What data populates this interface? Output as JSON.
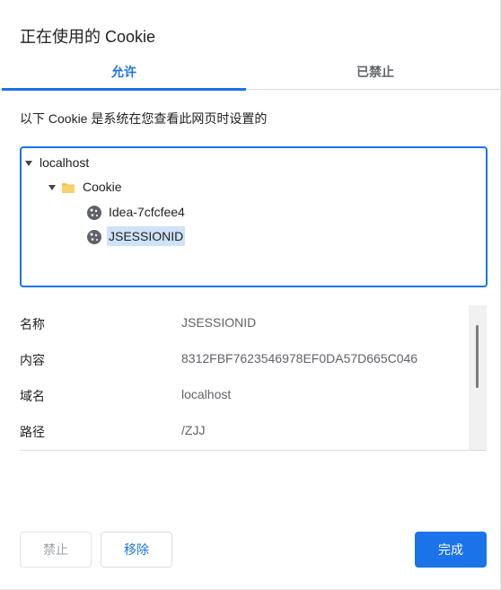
{
  "dialog": {
    "title": "正在使用的 Cookie",
    "tabs": [
      {
        "label": "允许",
        "selected": true
      },
      {
        "label": "已禁止",
        "selected": false
      }
    ],
    "description": "以下 Cookie 是系统在您查看此网页时设置的"
  },
  "tree": {
    "root": "localhost",
    "folder": "Cookie",
    "items": [
      "Idea-7cfcfee4",
      "JSESSIONID"
    ],
    "selected": "JSESSIONID"
  },
  "details": [
    {
      "key": "名称",
      "value": "JSESSIONID"
    },
    {
      "key": "内容",
      "value": "8312FBF7623546978EF0DA57D665C046"
    },
    {
      "key": "域名",
      "value": "localhost"
    },
    {
      "key": "路径",
      "value": "/ZJJ"
    }
  ],
  "buttons": {
    "block": "禁止",
    "remove": "移除",
    "done": "完成"
  },
  "colors": {
    "accent": "#1a73e8",
    "selection": "#cfe2f7"
  }
}
